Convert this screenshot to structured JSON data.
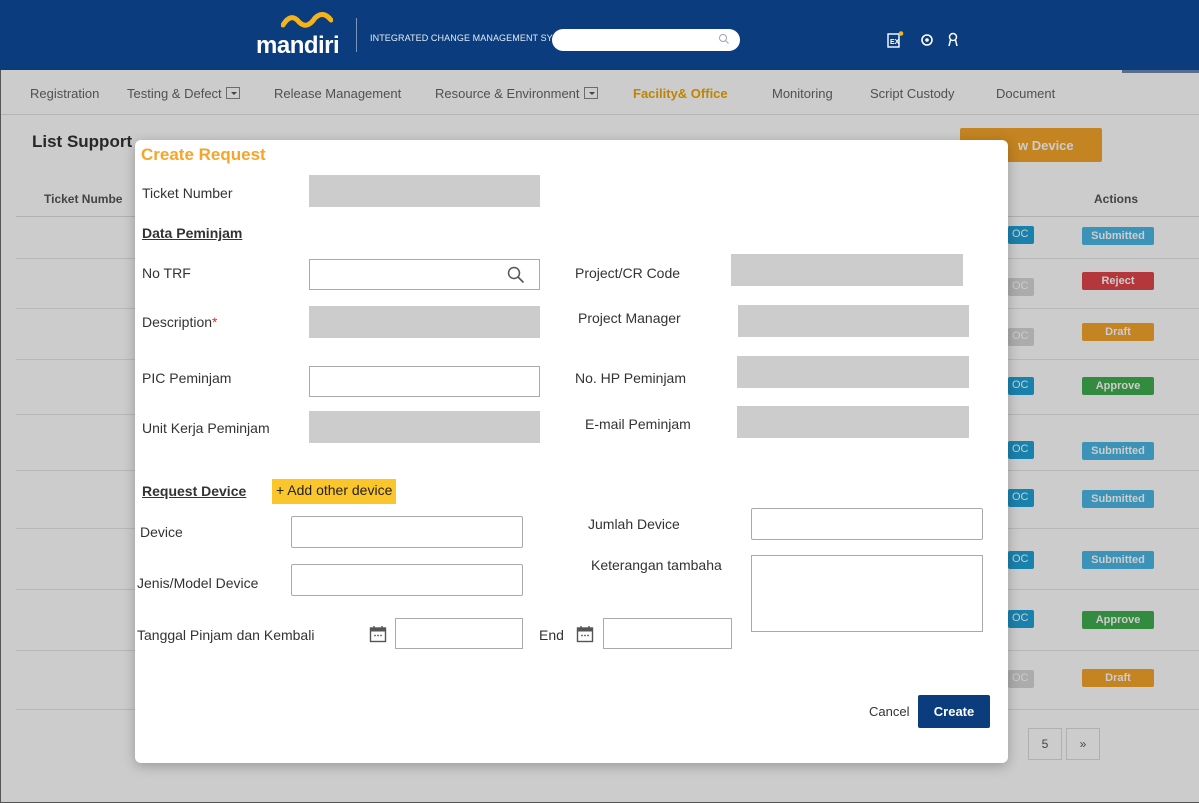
{
  "header": {
    "logo_text": "mandiri",
    "system_title": "INTEGRATED CHANGE MANAGEMENT SYSTEM",
    "search_placeholder": "",
    "brand_color": "#0b3d7e",
    "icons": [
      "ex-report-icon",
      "settings-icon",
      "user-icon"
    ]
  },
  "nav": {
    "items": [
      {
        "label": "Registration"
      },
      {
        "label": "Testing & Defect"
      },
      {
        "label": "Release Management"
      },
      {
        "label": "Resource & Environment"
      },
      {
        "label": "Facility& Office",
        "active": true
      },
      {
        "label": "Monitoring"
      },
      {
        "label": "Script Custody"
      },
      {
        "label": "Document"
      }
    ]
  },
  "page": {
    "title": "List Supporting Device",
    "title_visible": "List Support",
    "new_device_button": "New Device",
    "new_device_visible": "w Device",
    "columns": {
      "ticket_number": "Ticket Number",
      "ticket_visible": "Ticket Numbe",
      "actions": "Actions"
    },
    "rows": [
      {
        "tag": "OC",
        "status": "Submitted",
        "status_color": "#4cb8e6"
      },
      {
        "tag": "OC",
        "status": "Reject",
        "status_color": "#e0454a"
      },
      {
        "tag": "OC",
        "status": "Draft",
        "status_color": "#f4a52a"
      },
      {
        "tag": "OC",
        "status": "Approve",
        "status_color": "#3fae4e"
      },
      {
        "tag": "OC",
        "status": "Submitted",
        "status_color": "#4cb8e6"
      },
      {
        "tag": "OC",
        "status": "Submitted",
        "status_color": "#4cb8e6"
      },
      {
        "tag": "OC",
        "status": "Submitted",
        "status_color": "#4cb8e6"
      },
      {
        "tag": "OC",
        "status": "Approve",
        "status_color": "#3fae4e"
      },
      {
        "tag": "OC",
        "status": "Draft",
        "status_color": "#f4a52a"
      }
    ],
    "pagination": {
      "page_5": "5",
      "next": "»"
    }
  },
  "modal": {
    "title": "Create Request",
    "ticket_number_label": "Ticket Number",
    "ticket_number_value": "",
    "section_peminjam": "Data Peminjam",
    "fields": {
      "no_trf": {
        "label": "No TRF",
        "value": ""
      },
      "project_cr_code": {
        "label": "Project/CR Code",
        "value": ""
      },
      "description": {
        "label": "Description",
        "required_mark": "*",
        "value": ""
      },
      "project_manager": {
        "label": "Project Manager",
        "value": ""
      },
      "pic_peminjam": {
        "label": "PIC Peminjam",
        "value": ""
      },
      "no_hp_peminjam": {
        "label": "No. HP Peminjam",
        "value": ""
      },
      "unit_kerja_peminjam": {
        "label": "Unit Kerja Peminjam",
        "value": ""
      },
      "email_peminjam": {
        "label": "E-mail Peminjam",
        "value": ""
      }
    },
    "section_request_device": "Request Device",
    "add_other_device": "+ Add other device",
    "device": {
      "label": "Device",
      "selected": ""
    },
    "jumlah_device": {
      "label": "Jumlah Device",
      "selected": ""
    },
    "jenis_model_device": {
      "label": "Jenis/Model Device",
      "selected": ""
    },
    "keterangan_tambahan": {
      "label": "Keterangan tambaha",
      "value": ""
    },
    "tanggal_pinjam_kembali": {
      "label": "Tanggal Pinjam dan Kembali",
      "start_value": "",
      "end_label": "End",
      "end_value": ""
    },
    "cancel_button": "Cancel",
    "create_button": "Create",
    "accent_color": "#f4a52a"
  }
}
